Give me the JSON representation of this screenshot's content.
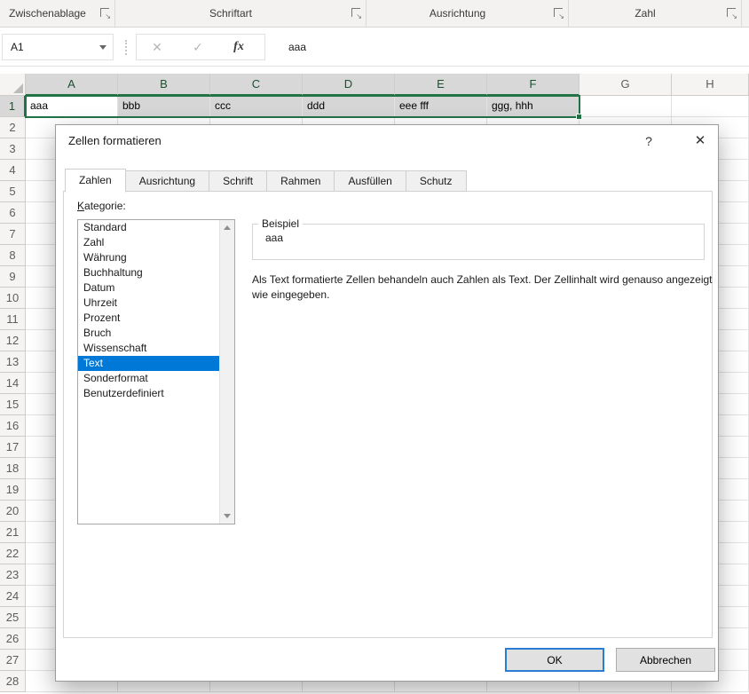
{
  "ribbon": {
    "groups": [
      {
        "label": "Zwischenablage"
      },
      {
        "label": "Schriftart"
      },
      {
        "label": "Ausrichtung"
      },
      {
        "label": "Zahl"
      }
    ]
  },
  "formula_bar": {
    "name_box": "A1",
    "cancel_icon": "✕",
    "enter_icon": "✓",
    "fx_icon": "fx",
    "value": "aaa"
  },
  "grid": {
    "columns": [
      "A",
      "B",
      "C",
      "D",
      "E",
      "F",
      "G",
      "H"
    ],
    "selected_columns": [
      "A",
      "B",
      "C",
      "D",
      "E",
      "F"
    ],
    "row_count": 28,
    "row1": {
      "A": "aaa",
      "B": "bbb",
      "C": "ccc",
      "D": "ddd",
      "E": "eee fff",
      "F": "ggg, hhh"
    }
  },
  "dialog": {
    "title": "Zellen formatieren",
    "help_icon": "?",
    "close_icon": "✕",
    "tabs": [
      {
        "id": "zahlen",
        "label": "Zahlen",
        "active": true
      },
      {
        "id": "ausrichtung",
        "label": "Ausrichtung",
        "active": false
      },
      {
        "id": "schrift",
        "label": "Schrift",
        "active": false
      },
      {
        "id": "rahmen",
        "label": "Rahmen",
        "active": false
      },
      {
        "id": "ausfuellen",
        "label": "Ausfüllen",
        "active": false
      },
      {
        "id": "schutz",
        "label": "Schutz",
        "active": false
      }
    ],
    "kategorie_label": "Kategorie:",
    "categories": [
      "Standard",
      "Zahl",
      "Währung",
      "Buchhaltung",
      "Datum",
      "Uhrzeit",
      "Prozent",
      "Bruch",
      "Wissenschaft",
      "Text",
      "Sonderformat",
      "Benutzerdefiniert"
    ],
    "selected_category": "Text",
    "beispiel_label": "Beispiel",
    "beispiel_value": "aaa",
    "description": "Als Text formatierte Zellen behandeln auch Zahlen als Text. Der Zellinhalt wird genauso angezeigt wie eingegeben.",
    "ok_label": "OK",
    "cancel_label": "Abbrechen"
  },
  "colors": {
    "accent_green": "#217346",
    "selection_blue": "#0078d7",
    "selected_fill": "#d6d6d6"
  }
}
